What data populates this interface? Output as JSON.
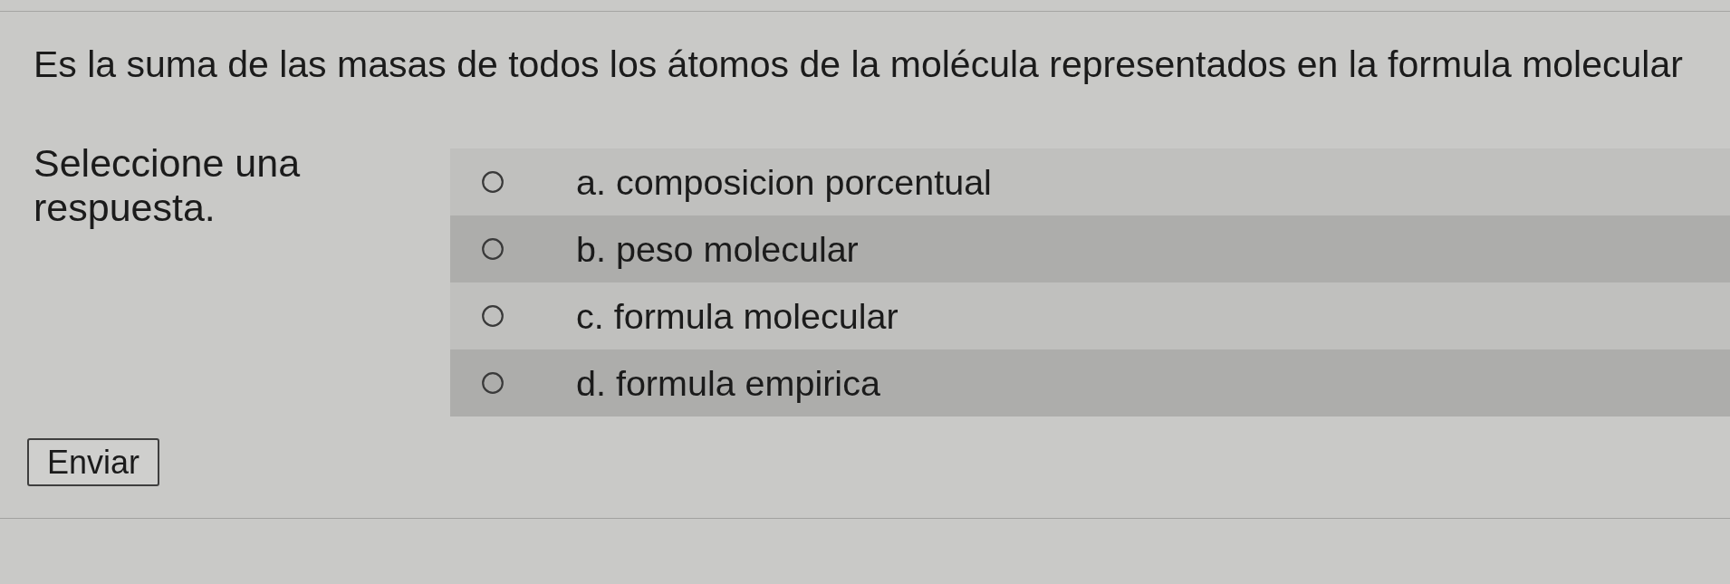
{
  "question": {
    "text": "Es la suma de las masas de todos los átomos de la molécula representados en la formula molecular"
  },
  "prompt": "Seleccione una respuesta.",
  "options": [
    {
      "label": "a. composicion porcentual",
      "selected": false
    },
    {
      "label": "b. peso molecular",
      "selected": false
    },
    {
      "label": "c. formula molecular",
      "selected": false
    },
    {
      "label": "d. formula empirica",
      "selected": false
    }
  ],
  "submit_button": "Enviar"
}
